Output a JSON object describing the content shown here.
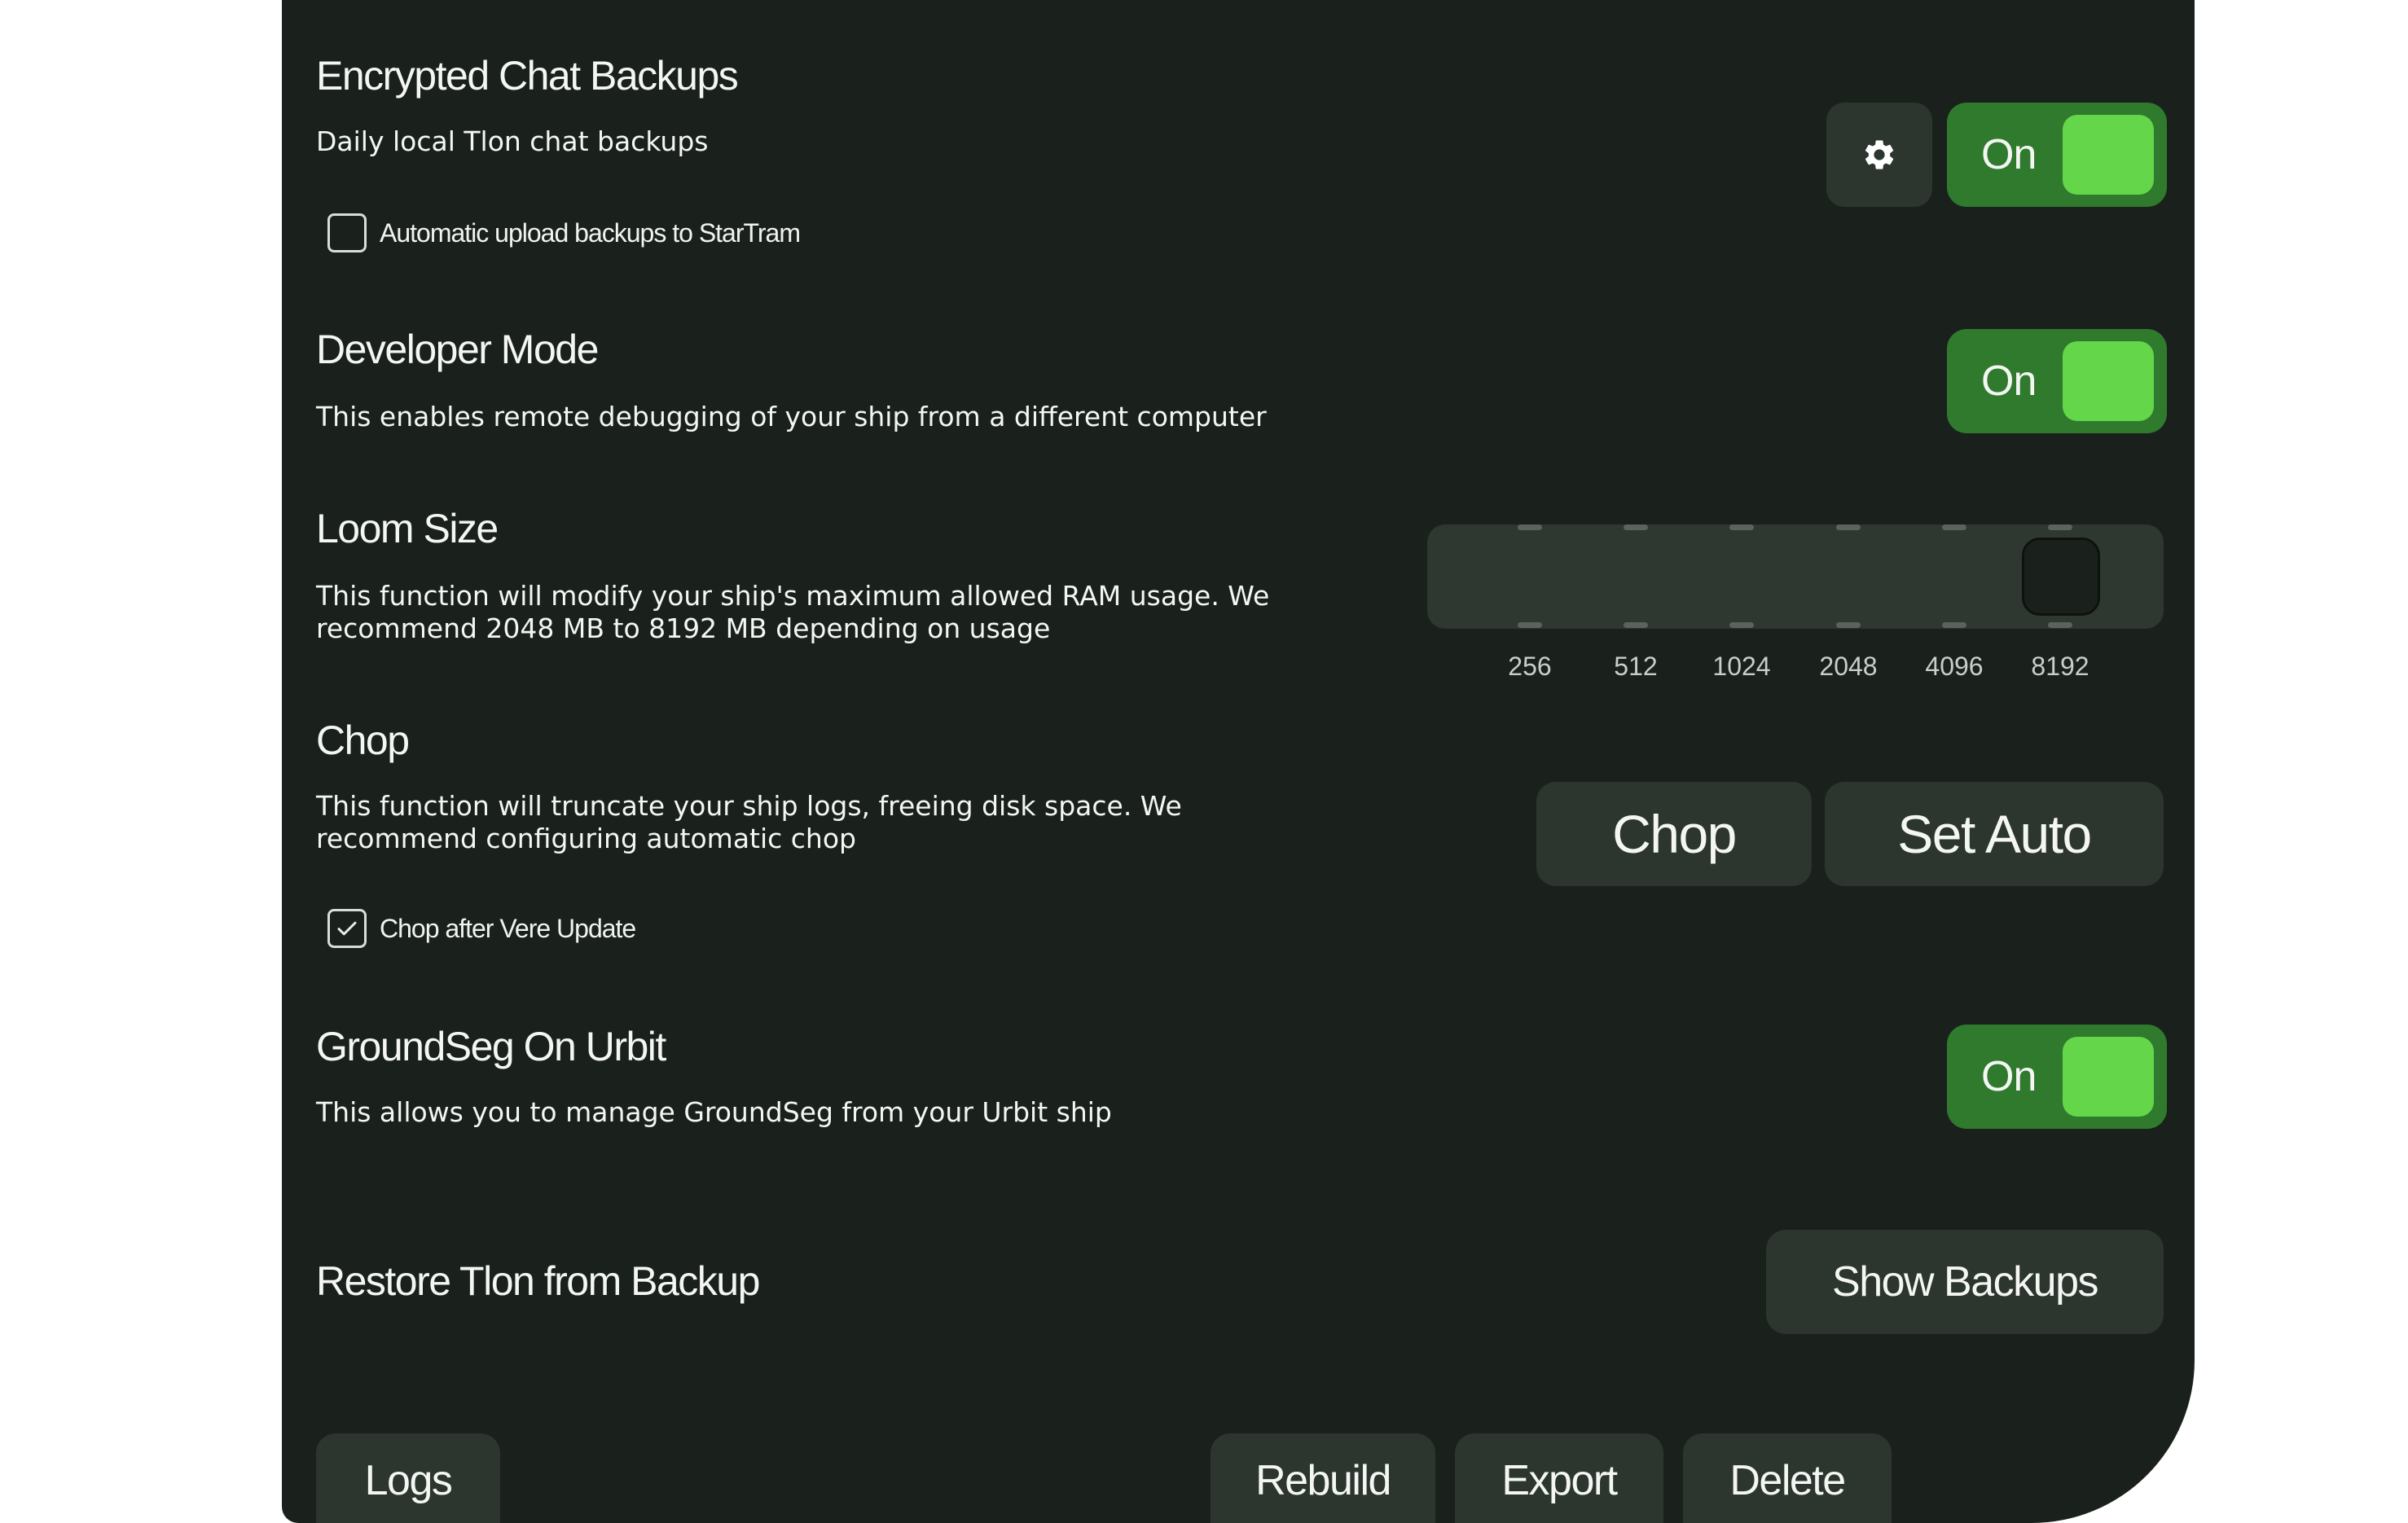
{
  "settings": {
    "encrypted_backups": {
      "title": "Encrypted Chat Backups",
      "description": "Daily local Tlon chat backups",
      "checkbox_label": "Automatic upload backups to StarTram",
      "checkbox_checked": false,
      "toggle_label": "On",
      "toggle_on": true
    },
    "developer_mode": {
      "title": "Developer Mode",
      "description": "This enables remote debugging of your ship from a different computer",
      "toggle_label": "On",
      "toggle_on": true
    },
    "loom_size": {
      "title": "Loom Size",
      "description_line1": "This function will modify your ship's maximum allowed RAM usage. We",
      "description_line2": "recommend 2048 MB to 8192 MB depending on usage",
      "options": [
        "256",
        "512",
        "1024",
        "2048",
        "4096",
        "8192"
      ],
      "selected": "8192"
    },
    "chop": {
      "title": "Chop",
      "description_line1": "This function will truncate your ship logs, freeing disk space. We",
      "description_line2": "recommend configuring automatic chop",
      "chop_button": "Chop",
      "set_auto_button": "Set Auto",
      "checkbox_label": "Chop after Vere Update",
      "checkbox_checked": true
    },
    "groundseg_on_urbit": {
      "title": "GroundSeg On Urbit",
      "description": "This allows you to manage GroundSeg from your Urbit ship",
      "toggle_label": "On",
      "toggle_on": true
    },
    "restore_tlon": {
      "title": "Restore Tlon from Backup",
      "button": "Show Backups"
    }
  },
  "footer": {
    "logs": "Logs",
    "rebuild": "Rebuild",
    "export": "Export",
    "delete": "Delete"
  },
  "colors": {
    "panel_bg": "#1a211c",
    "toggle_bg": "#2f7a2c",
    "toggle_knob": "#64d64a",
    "button_bg": "#2c352e"
  }
}
